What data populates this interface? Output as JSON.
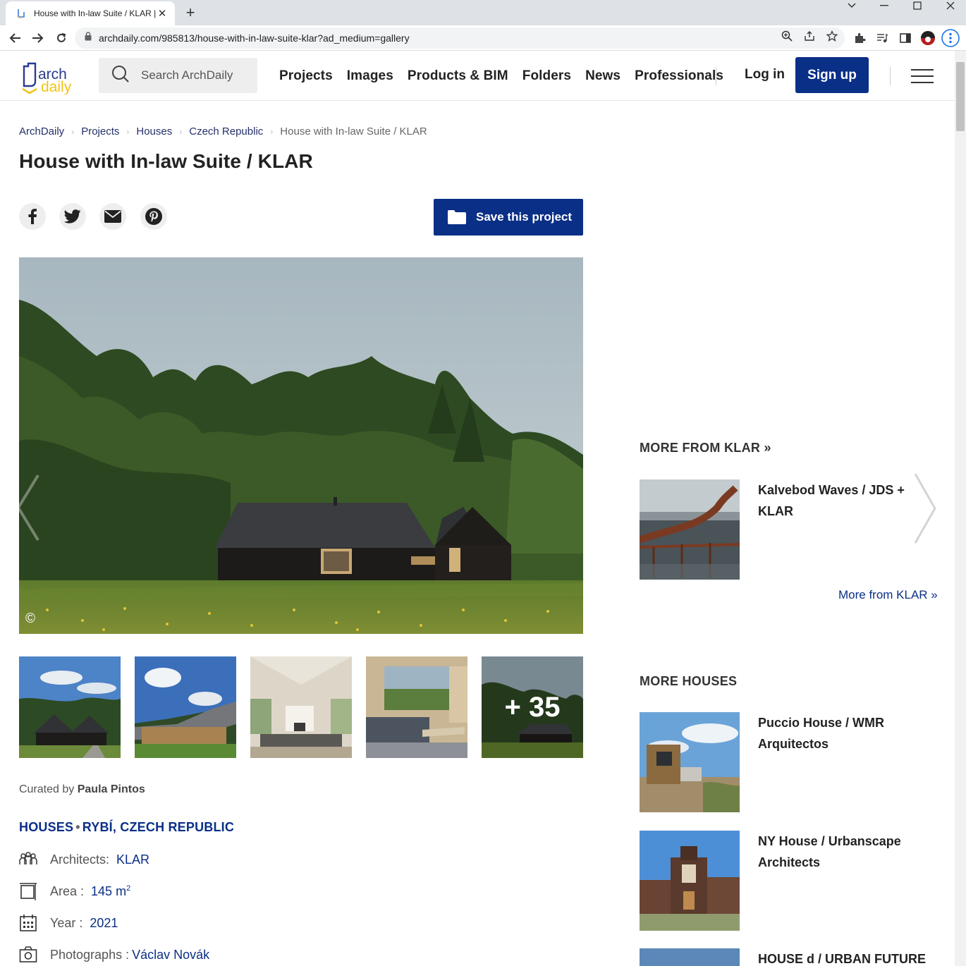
{
  "browser": {
    "tab_title": "House with In-law Suite / KLAR |",
    "url": "archdaily.com/985813/house-with-in-law-suite-klar?ad_medium=gallery"
  },
  "header": {
    "logo_text_top": "arch",
    "logo_text_bottom": "daily",
    "search_placeholder": "Search ArchDaily",
    "nav": [
      "Projects",
      "Images",
      "Products & BIM",
      "Folders",
      "News",
      "Professionals"
    ],
    "login": "Log in",
    "signup": "Sign up"
  },
  "breadcrumb": [
    "ArchDaily",
    "Projects",
    "Houses",
    "Czech Republic",
    "House with In-law Suite / KLAR"
  ],
  "title": "House with In-law Suite / KLAR",
  "save_label": "Save this project",
  "hero": {
    "copyright_symbol": "©"
  },
  "gallery": {
    "more_count": "+ 35"
  },
  "curated": {
    "prefix": "Curated by",
    "name": "Paula Pintos"
  },
  "taxonomy": {
    "category": "HOUSES",
    "dot": "•",
    "location": "RYBÍ, CZECH REPUBLIC"
  },
  "specs": {
    "architects_label": "Architects:",
    "architects_value": "KLAR",
    "area_label": "Area :",
    "area_value": "145 m",
    "area_unit_sup": "2",
    "year_label": "Year :",
    "year_value": "2021",
    "photographs_label": "Photographs :",
    "photographs_value": "Václav Novák"
  },
  "sidebar": {
    "more_from_heading": "MORE FROM KLAR »",
    "more_from_items": [
      {
        "title": "Kalvebod Waves / JDS + KLAR"
      }
    ],
    "more_from_link": "More from KLAR »",
    "more_houses_heading": "MORE HOUSES",
    "more_houses_items": [
      {
        "title": "Puccio House / WMR Arquitectos"
      },
      {
        "title": "NY House / Urbanscape Architects"
      },
      {
        "title": "HOUSE d / URBAN FUTURE"
      }
    ]
  },
  "colors": {
    "brand_blue": "#0a2f87",
    "link_blue": "#25306b",
    "logo_yellow": "#f2c318"
  }
}
